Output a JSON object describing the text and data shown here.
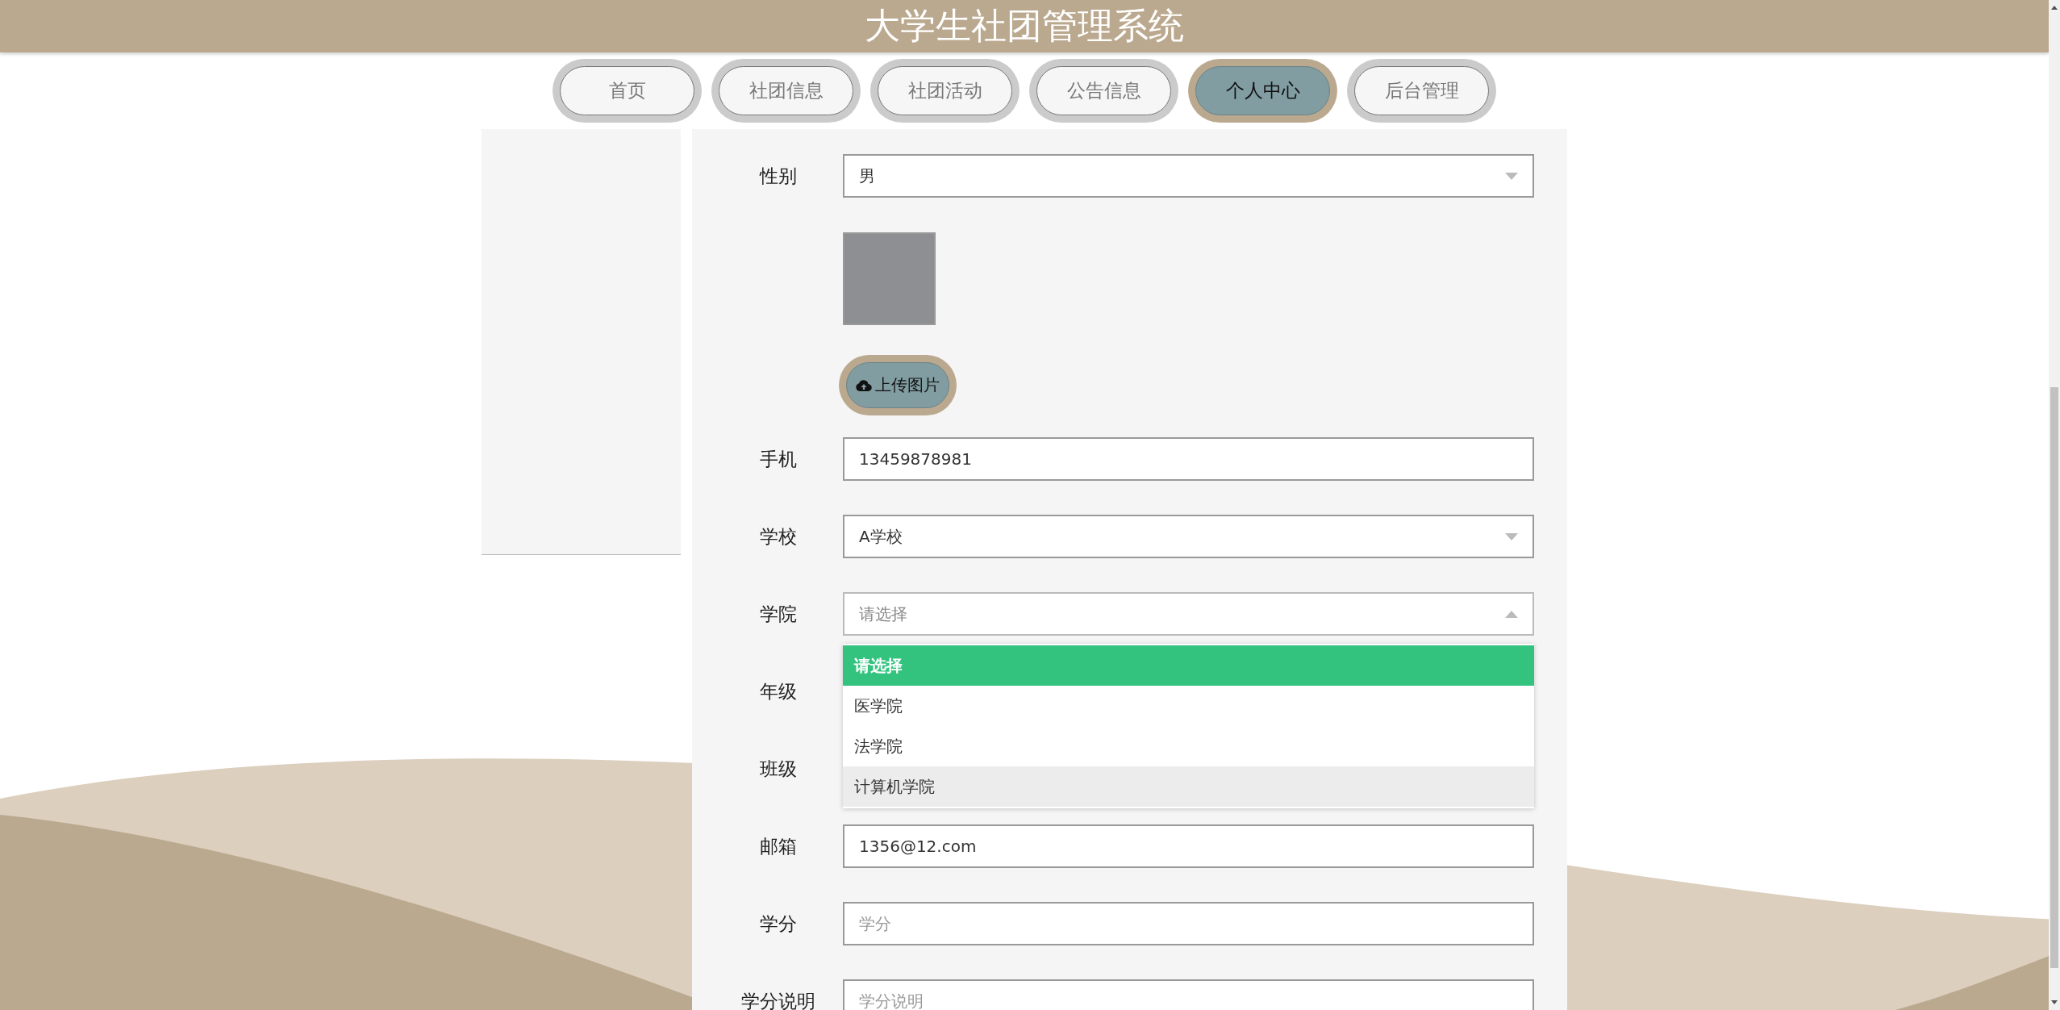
{
  "header": {
    "title": "大学生社团管理系统"
  },
  "nav": [
    {
      "label": "首页",
      "selected": false
    },
    {
      "label": "社团信息",
      "selected": false
    },
    {
      "label": "社团活动",
      "selected": false
    },
    {
      "label": "公告信息",
      "selected": false
    },
    {
      "label": "个人中心",
      "selected": true
    },
    {
      "label": "后台管理",
      "selected": false
    }
  ],
  "form": {
    "fields": [
      {
        "kind": "select",
        "label": "性别",
        "value": "男",
        "expanded": false
      },
      {
        "kind": "image"
      },
      {
        "kind": "upload",
        "button": "上传图片"
      },
      {
        "kind": "text",
        "label": "手机",
        "value": "13459878981"
      },
      {
        "kind": "select",
        "label": "学校",
        "value": "A学校",
        "expanded": false
      },
      {
        "kind": "select",
        "label": "学院",
        "placeholder": "请选择",
        "expanded": true,
        "options": [
          {
            "label": "请选择",
            "selected": true,
            "hovered": false
          },
          {
            "label": "医学院",
            "selected": false,
            "hovered": false
          },
          {
            "label": "法学院",
            "selected": false,
            "hovered": false
          },
          {
            "label": "计算机学院",
            "selected": false,
            "hovered": true
          }
        ]
      },
      {
        "kind": "covered",
        "label": "年级"
      },
      {
        "kind": "covered",
        "label": "班级"
      },
      {
        "kind": "text",
        "label": "邮箱",
        "value": "1356@12.com"
      },
      {
        "kind": "text",
        "label": "学分",
        "placeholder": "学分"
      },
      {
        "kind": "text",
        "label": "学分说明",
        "placeholder": "学分说明"
      }
    ]
  }
}
